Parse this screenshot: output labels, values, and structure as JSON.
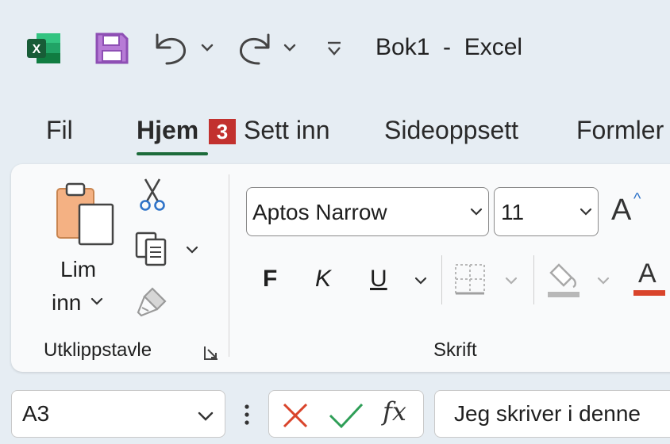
{
  "app": {
    "title": "Bok1  -  Excel"
  },
  "tabs": [
    {
      "label": "Fil"
    },
    {
      "label": "Hjem"
    },
    {
      "label": "Sett inn"
    },
    {
      "label": "Sideoppsett"
    },
    {
      "label": "Formler"
    }
  ],
  "annotation_badge": "3",
  "clipboard": {
    "paste_line1": "Lim",
    "paste_line2": "inn",
    "group_label": "Utklippstavle"
  },
  "font": {
    "font_name": "Aptos Narrow",
    "font_size": "11",
    "bold_label": "F",
    "italic_label": "K",
    "underline_label": "U",
    "font_color_label": "A",
    "grow_label": "A",
    "group_label": "Skrift",
    "fill_color": "#f2c700",
    "font_color": "#d9442b"
  },
  "formula_bar": {
    "name_box": "A3",
    "fx_label": "fx",
    "content": "Jeg skriver i denne"
  },
  "colors": {
    "accent_green": "#1c6b3a",
    "excel_green": "#1e7145",
    "save_purple": "#8e4fb4"
  }
}
